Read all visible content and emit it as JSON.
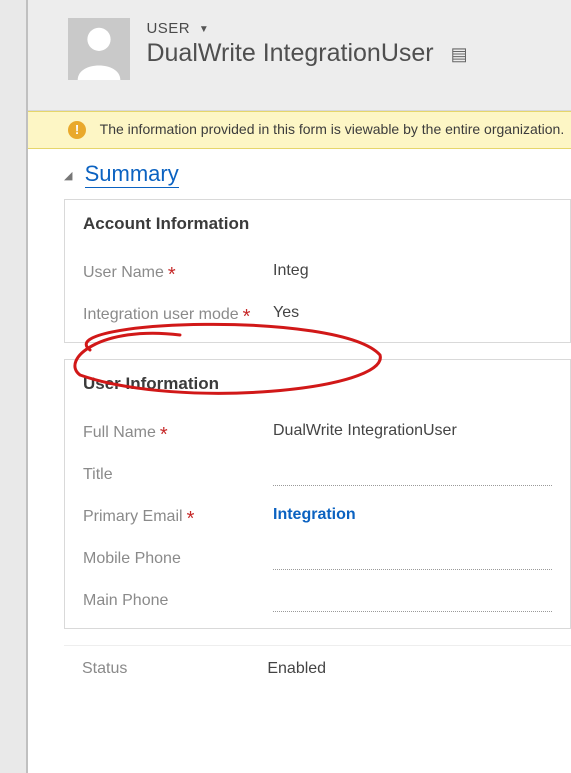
{
  "header": {
    "entity_label": "USER",
    "record_name": "DualWrite IntegrationUser"
  },
  "notification": {
    "text": "The information provided in this form is viewable by the entire organization."
  },
  "section": {
    "summary_label": "Summary"
  },
  "account_info": {
    "title": "Account Information",
    "fields": {
      "username_label": "User Name",
      "username_value": "Integ",
      "integration_mode_label": "Integration user mode",
      "integration_mode_value": "Yes"
    }
  },
  "user_info": {
    "title": "User Information",
    "fields": {
      "fullname_label": "Full Name",
      "fullname_value": "DualWrite IntegrationUser",
      "title_label": "Title",
      "title_value": "",
      "email_label": "Primary Email",
      "email_value": "Integration",
      "mobile_label": "Mobile Phone",
      "mobile_value": "",
      "mainphone_label": "Main Phone",
      "mainphone_value": ""
    }
  },
  "status": {
    "label": "Status",
    "value": "Enabled"
  }
}
